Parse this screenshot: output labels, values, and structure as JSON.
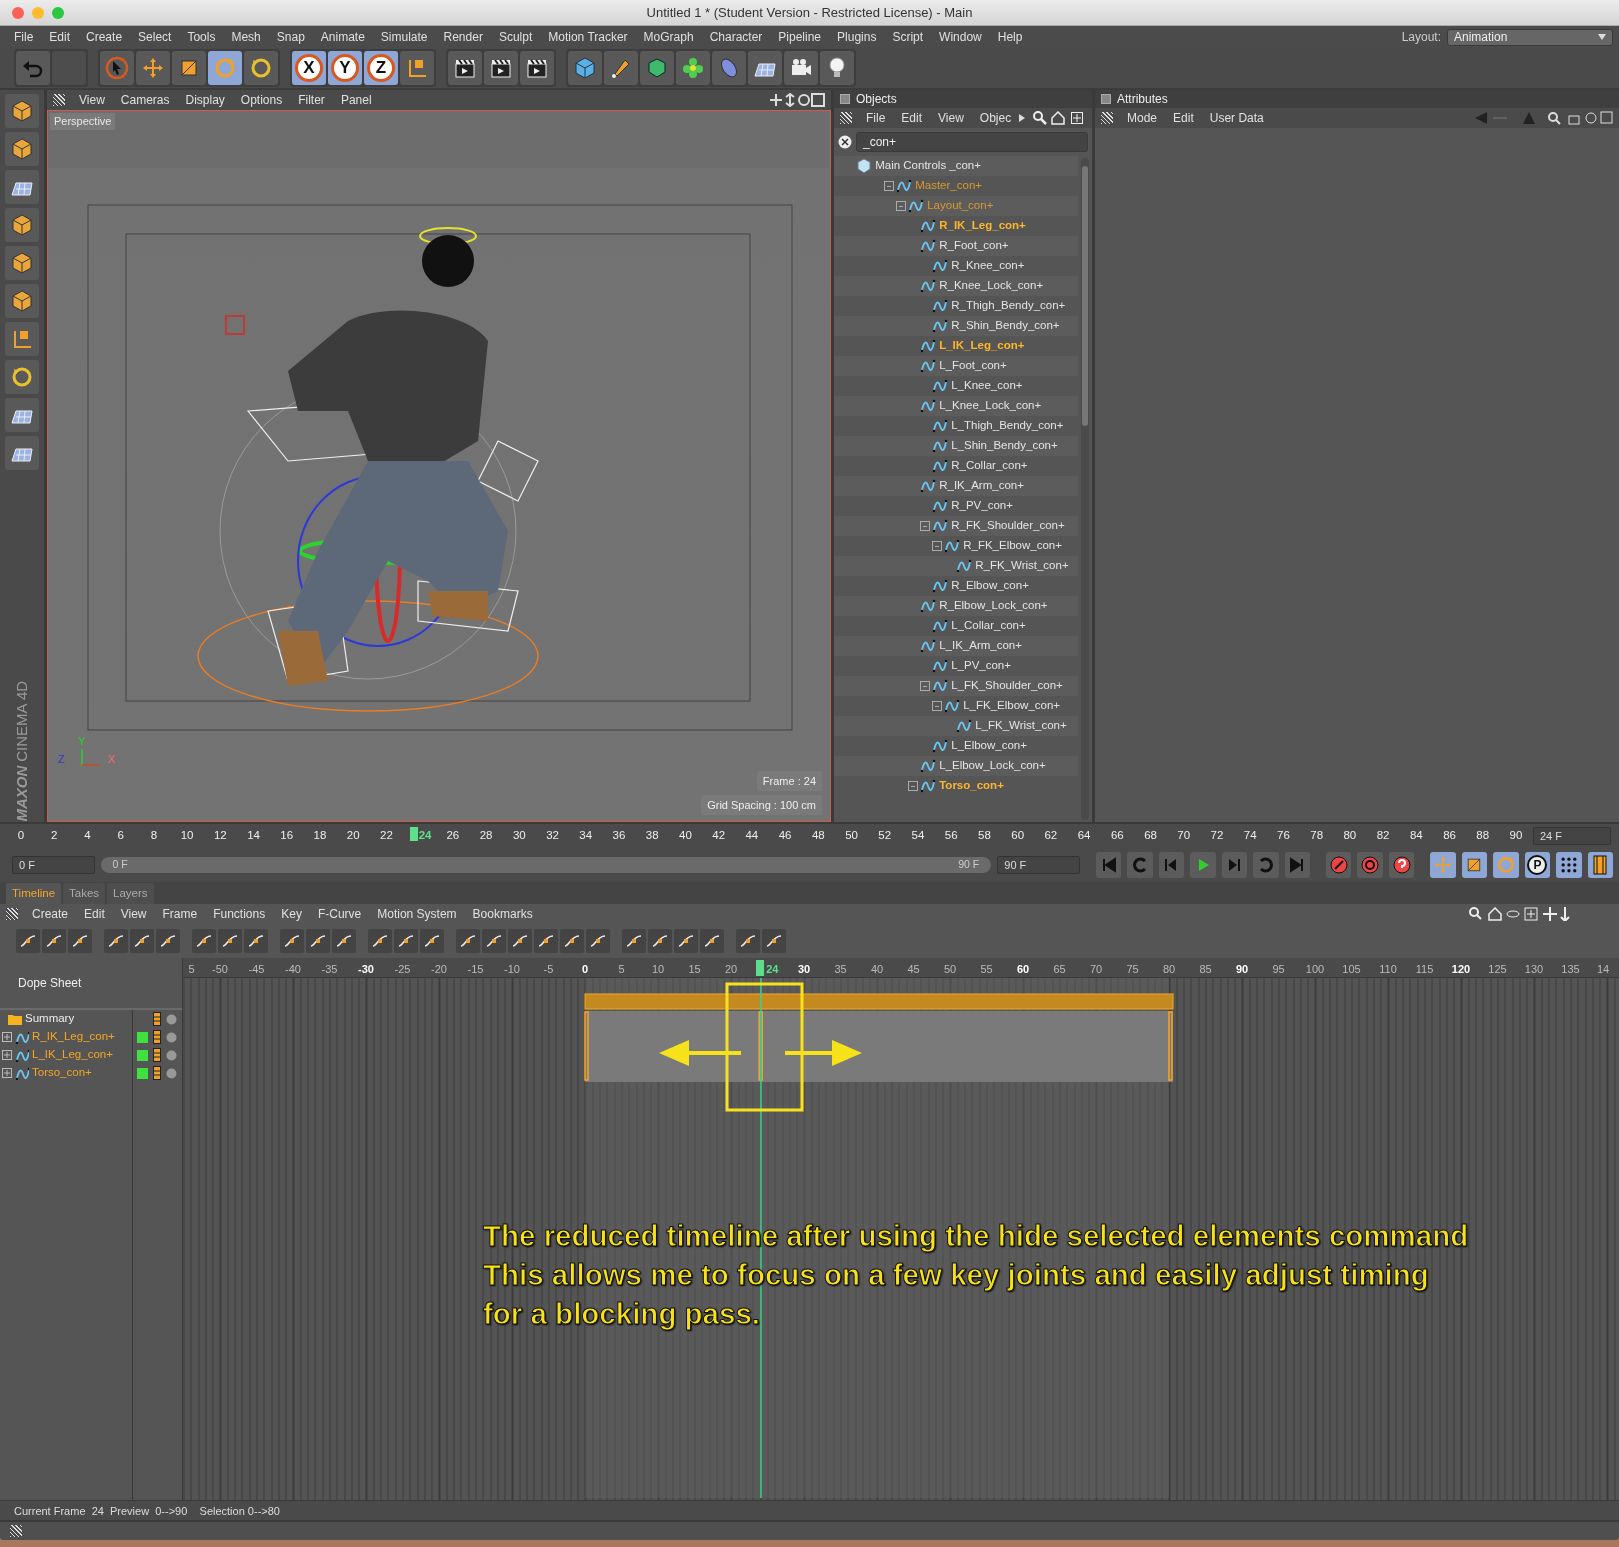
{
  "window": {
    "title": "Untitled 1 * (Student Version - Restricted License) - Main"
  },
  "menu": [
    "File",
    "Edit",
    "Create",
    "Select",
    "Tools",
    "Mesh",
    "Snap",
    "Animate",
    "Simulate",
    "Render",
    "Sculpt",
    "Motion Tracker",
    "MoGraph",
    "Character",
    "Pipeline",
    "Plugins",
    "Script",
    "Window",
    "Help"
  ],
  "layout": {
    "label": "Layout:",
    "value": "Animation"
  },
  "tools": [
    {
      "kind": "select",
      "selected": false
    },
    {
      "kind": "move",
      "selected": false
    },
    {
      "kind": "scale",
      "selected": false
    },
    {
      "kind": "rotate",
      "selected": true
    },
    {
      "kind": "recent",
      "selected": false
    }
  ],
  "axis_buttons": [
    {
      "label": "X",
      "on": true
    },
    {
      "label": "Y",
      "on": true
    },
    {
      "label": "Z",
      "on": true
    }
  ],
  "viewport": {
    "menu": [
      "View",
      "Cameras",
      "Display",
      "Options",
      "Filter",
      "Panel"
    ],
    "camera": "Perspective",
    "frame": "Frame : 24",
    "grid_spacing": "Grid Spacing : 100 cm",
    "axes": {
      "x": "X",
      "y": "Y",
      "z": "Z"
    },
    "logo": [
      "MAXON",
      "CINEMA 4D"
    ]
  },
  "objects": {
    "title": "Objects",
    "menu": [
      "File",
      "Edit",
      "View",
      "Objec"
    ],
    "search": "_con+",
    "tree": [
      {
        "name": "Main Controls _con+",
        "kind": "null",
        "selected": false,
        "highlighted": false,
        "expanded": false,
        "children": [
          {
            "name": "Master_con+",
            "kind": "control",
            "selected": false,
            "highlighted": true,
            "expanded": true,
            "children": [
              {
                "name": "Layout_con+",
                "kind": "control",
                "selected": false,
                "highlighted": true,
                "expanded": true,
                "children": [
                  {
                    "name": "R_IK_Leg_con+",
                    "kind": "control",
                    "selected": true,
                    "highlighted": false,
                    "expanded": false
                  },
                  {
                    "name": "R_Foot_con+",
                    "kind": "control",
                    "selected": false,
                    "highlighted": false,
                    "expanded": false,
                    "children": [
                      {
                        "name": "R_Knee_con+",
                        "kind": "control",
                        "selected": false,
                        "highlighted": false,
                        "expanded": false
                      }
                    ]
                  },
                  {
                    "name": "R_Knee_Lock_con+",
                    "kind": "control",
                    "selected": false,
                    "highlighted": false,
                    "expanded": false,
                    "children": [
                      {
                        "name": "R_Thigh_Bendy_con+",
                        "kind": "control",
                        "selected": false,
                        "highlighted": false,
                        "expanded": false
                      },
                      {
                        "name": "R_Shin_Bendy_con+",
                        "kind": "control",
                        "selected": false,
                        "highlighted": false,
                        "expanded": false
                      }
                    ]
                  },
                  {
                    "name": "L_IK_Leg_con+",
                    "kind": "control",
                    "selected": true,
                    "highlighted": false,
                    "expanded": false
                  },
                  {
                    "name": "L_Foot_con+",
                    "kind": "control",
                    "selected": false,
                    "highlighted": false,
                    "expanded": false,
                    "children": [
                      {
                        "name": "L_Knee_con+",
                        "kind": "control",
                        "selected": false,
                        "highlighted": false,
                        "expanded": false
                      }
                    ]
                  },
                  {
                    "name": "L_Knee_Lock_con+",
                    "kind": "control",
                    "selected": false,
                    "highlighted": false,
                    "expanded": false,
                    "children": [
                      {
                        "name": "L_Thigh_Bendy_con+",
                        "kind": "control",
                        "selected": false,
                        "highlighted": false,
                        "expanded": false
                      },
                      {
                        "name": "L_Shin_Bendy_con+",
                        "kind": "control",
                        "selected": false,
                        "highlighted": false,
                        "expanded": false
                      },
                      {
                        "name": "R_Collar_con+",
                        "kind": "control",
                        "selected": false,
                        "highlighted": false,
                        "expanded": false
                      }
                    ]
                  },
                  {
                    "name": "R_IK_Arm_con+",
                    "kind": "control",
                    "selected": false,
                    "highlighted": false,
                    "expanded": false,
                    "children": [
                      {
                        "name": "R_PV_con+",
                        "kind": "control",
                        "selected": false,
                        "highlighted": false,
                        "expanded": false
                      },
                      {
                        "name": "R_FK_Shoulder_con+",
                        "kind": "control",
                        "selected": false,
                        "highlighted": false,
                        "expanded": true,
                        "children": [
                          {
                            "name": "R_FK_Elbow_con+",
                            "kind": "control",
                            "selected": false,
                            "highlighted": false,
                            "expanded": true,
                            "children": [
                              {
                                "name": "R_FK_Wrist_con+",
                                "kind": "control",
                                "selected": false,
                                "highlighted": false,
                                "expanded": false
                              }
                            ]
                          }
                        ]
                      },
                      {
                        "name": "R_Elbow_con+",
                        "kind": "control",
                        "selected": false,
                        "highlighted": false,
                        "expanded": false
                      }
                    ]
                  },
                  {
                    "name": "R_Elbow_Lock_con+",
                    "kind": "control",
                    "selected": false,
                    "highlighted": false,
                    "expanded": false,
                    "children": [
                      {
                        "name": "L_Collar_con+",
                        "kind": "control",
                        "selected": false,
                        "highlighted": false,
                        "expanded": false
                      }
                    ]
                  },
                  {
                    "name": "L_IK_Arm_con+",
                    "kind": "control",
                    "selected": false,
                    "highlighted": false,
                    "expanded": false,
                    "children": [
                      {
                        "name": "L_PV_con+",
                        "kind": "control",
                        "selected": false,
                        "highlighted": false,
                        "expanded": false
                      },
                      {
                        "name": "L_FK_Shoulder_con+",
                        "kind": "control",
                        "selected": false,
                        "highlighted": false,
                        "expanded": true,
                        "children": [
                          {
                            "name": "L_FK_Elbow_con+",
                            "kind": "control",
                            "selected": false,
                            "highlighted": false,
                            "expanded": true,
                            "children": [
                              {
                                "name": "L_FK_Wrist_con+",
                                "kind": "control",
                                "selected": false,
                                "highlighted": false,
                                "expanded": false
                              }
                            ]
                          }
                        ]
                      },
                      {
                        "name": "L_Elbow_con+",
                        "kind": "control",
                        "selected": false,
                        "highlighted": false,
                        "expanded": false
                      }
                    ]
                  },
                  {
                    "name": "L_Elbow_Lock_con+",
                    "kind": "control",
                    "selected": false,
                    "highlighted": false,
                    "expanded": false
                  },
                  {
                    "name": "Torso_con+",
                    "kind": "control",
                    "selected": true,
                    "highlighted": false,
                    "expanded": true
                  }
                ]
              }
            ]
          }
        ]
      }
    ]
  },
  "attributes": {
    "title": "Attributes",
    "menu": [
      "Mode",
      "Edit",
      "User Data"
    ]
  },
  "ruler": {
    "ticks": [
      {
        "label": "0",
        "selected": false
      },
      {
        "label": "2",
        "selected": false
      },
      {
        "label": "4",
        "selected": false
      },
      {
        "label": "6",
        "selected": false
      },
      {
        "label": "8",
        "selected": false
      },
      {
        "label": "10",
        "selected": false
      },
      {
        "label": "12",
        "selected": false
      },
      {
        "label": "14",
        "selected": false
      },
      {
        "label": "16",
        "selected": false
      },
      {
        "label": "18",
        "selected": false
      },
      {
        "label": "20",
        "selected": false
      },
      {
        "label": "22",
        "selected": false
      },
      {
        "label": "24",
        "selected": true
      },
      {
        "label": "26",
        "selected": false
      },
      {
        "label": "28",
        "selected": false
      },
      {
        "label": "30",
        "selected": false
      },
      {
        "label": "32",
        "selected": false
      },
      {
        "label": "34",
        "selected": false
      },
      {
        "label": "36",
        "selected": false
      },
      {
        "label": "38",
        "selected": false
      },
      {
        "label": "40",
        "selected": false
      },
      {
        "label": "42",
        "selected": false
      },
      {
        "label": "44",
        "selected": false
      },
      {
        "label": "46",
        "selected": false
      },
      {
        "label": "48",
        "selected": false
      },
      {
        "label": "50",
        "selected": false
      },
      {
        "label": "52",
        "selected": false
      },
      {
        "label": "54",
        "selected": false
      },
      {
        "label": "56",
        "selected": false
      },
      {
        "label": "58",
        "selected": false
      },
      {
        "label": "60",
        "selected": false
      },
      {
        "label": "62",
        "selected": false
      },
      {
        "label": "64",
        "selected": false
      },
      {
        "label": "66",
        "selected": false
      },
      {
        "label": "68",
        "selected": false
      },
      {
        "label": "70",
        "selected": false
      },
      {
        "label": "72",
        "selected": false
      },
      {
        "label": "74",
        "selected": false
      },
      {
        "label": "76",
        "selected": false
      },
      {
        "label": "78",
        "selected": false
      },
      {
        "label": "80",
        "selected": false
      },
      {
        "label": "82",
        "selected": false
      },
      {
        "label": "84",
        "selected": false
      },
      {
        "label": "86",
        "selected": false
      },
      {
        "label": "88",
        "selected": false
      },
      {
        "label": "90",
        "selected": false
      }
    ],
    "current": "24 F"
  },
  "transport": {
    "start": "0 F",
    "range": {
      "level": 1
    },
    "range_start": "0 F",
    "range_end": "90 F",
    "end": "90 F",
    "key_toggles": [
      {
        "kind": "position",
        "on": true
      },
      {
        "kind": "scale",
        "on": true
      },
      {
        "kind": "rotation",
        "on": true
      },
      {
        "kind": "parameter",
        "label": "P",
        "on": true
      },
      {
        "kind": "points",
        "on": true
      }
    ]
  },
  "timeline_tabs": [
    {
      "label": "Timeline",
      "selected": true
    },
    {
      "label": "Takes",
      "selected": false
    },
    {
      "label": "Layers",
      "selected": false
    }
  ],
  "timeline_menu": [
    "Create",
    "Edit",
    "View",
    "Frame",
    "Functions",
    "Key",
    "F-Curve",
    "Motion System",
    "Bookmarks"
  ],
  "dope_ruler": [
    {
      "label": "5",
      "major": false,
      "selected": false
    },
    {
      "label": "-50",
      "major": false,
      "selected": false
    },
    {
      "label": "-45",
      "major": false,
      "selected": false
    },
    {
      "label": "-40",
      "major": false,
      "selected": false
    },
    {
      "label": "-35",
      "major": false,
      "selected": false
    },
    {
      "label": "-30",
      "major": true,
      "selected": false
    },
    {
      "label": "-25",
      "major": false,
      "selected": false
    },
    {
      "label": "-20",
      "major": false,
      "selected": false
    },
    {
      "label": "-15",
      "major": false,
      "selected": false
    },
    {
      "label": "-10",
      "major": false,
      "selected": false
    },
    {
      "label": "-5",
      "major": false,
      "selected": false
    },
    {
      "label": "0",
      "major": true,
      "selected": false
    },
    {
      "label": "5",
      "major": false,
      "selected": false
    },
    {
      "label": "10",
      "major": false,
      "selected": false
    },
    {
      "label": "15",
      "major": false,
      "selected": false
    },
    {
      "label": "20",
      "major": false,
      "selected": false
    },
    {
      "label": "24",
      "major": false,
      "selected": true
    },
    {
      "label": "30",
      "major": true,
      "selected": false
    },
    {
      "label": "35",
      "major": false,
      "selected": false
    },
    {
      "label": "40",
      "major": false,
      "selected": false
    },
    {
      "label": "45",
      "major": false,
      "selected": false
    },
    {
      "label": "50",
      "major": false,
      "selected": false
    },
    {
      "label": "55",
      "major": false,
      "selected": false
    },
    {
      "label": "60",
      "major": true,
      "selected": false
    },
    {
      "label": "65",
      "major": false,
      "selected": false
    },
    {
      "label": "70",
      "major": false,
      "selected": false
    },
    {
      "label": "75",
      "major": false,
      "selected": false
    },
    {
      "label": "80",
      "major": false,
      "selected": false
    },
    {
      "label": "85",
      "major": false,
      "selected": false
    },
    {
      "label": "90",
      "major": true,
      "selected": false
    },
    {
      "label": "95",
      "major": false,
      "selected": false
    },
    {
      "label": "100",
      "major": false,
      "selected": false
    },
    {
      "label": "105",
      "major": false,
      "selected": false
    },
    {
      "label": "110",
      "major": false,
      "selected": false
    },
    {
      "label": "115",
      "major": false,
      "selected": false
    },
    {
      "label": "120",
      "major": true,
      "selected": false
    },
    {
      "label": "125",
      "major": false,
      "selected": false
    },
    {
      "label": "130",
      "major": false,
      "selected": false
    },
    {
      "label": "135",
      "major": false,
      "selected": false
    },
    {
      "label": "14",
      "major": false,
      "selected": false
    }
  ],
  "dope_sheet": {
    "title": "Dope Sheet",
    "summary": "Summary",
    "tracks": [
      {
        "name": "R_IK_Leg_con+",
        "enabled": true
      },
      {
        "name": "L_IK_Leg_con+",
        "enabled": true
      },
      {
        "name": "Torso_con+",
        "enabled": true
      }
    ]
  },
  "annotation": [
    "The reduced timeline after using the hide selected elements command",
    "This allows me to focus on a few key joints and easily adjust timing",
    "for a blocking pass."
  ],
  "status_bar": "Current Frame  24  Preview  0-->90    Selection 0-->80"
}
